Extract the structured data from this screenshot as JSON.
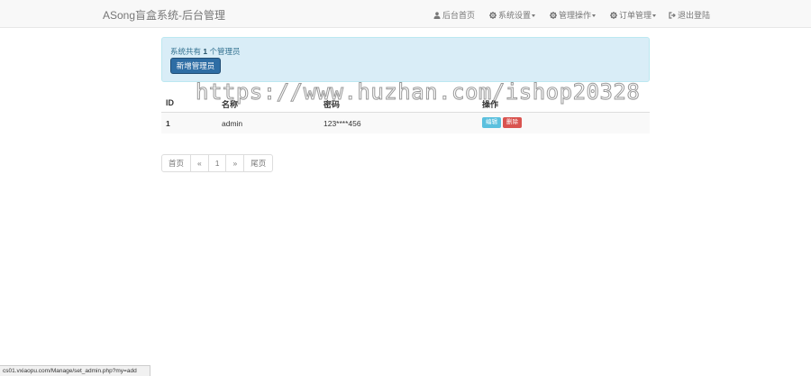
{
  "brand": "ASong盲盒系统-后台管理",
  "nav": {
    "home": "后台首页",
    "system": "系统设置",
    "manage": "管理操作",
    "orders": "订单管理",
    "logout": "退出登陆"
  },
  "icons": {
    "home": "user-icon",
    "system": "gear-icon",
    "manage": "gear-icon",
    "orders": "gear-icon",
    "logout": "logout-icon"
  },
  "alert": {
    "prefix": "系统共有",
    "count": "1",
    "suffix": "个管理员",
    "add_button": "新增管理员"
  },
  "table": {
    "headers": [
      "ID",
      "名称",
      "密码",
      "操作"
    ],
    "rows": [
      {
        "id": "1",
        "name": "admin",
        "password": "123****456",
        "edit": "编辑",
        "delete": "删除"
      }
    ]
  },
  "pagination": {
    "first": "首页",
    "prev": "«",
    "current": "1",
    "next": "»",
    "last": "尾页"
  },
  "watermark": "https://www.huzhan.com/ishop20328",
  "status_url": "cs01.vxiaopu.com/Manage/set_admin.php?my=add",
  "colors": {
    "primary": "#2e6da4",
    "alert_bg": "#d9edf7",
    "alert_text": "#31708f",
    "info": "#5bc0de",
    "danger": "#d9534f",
    "link": "#337ab7"
  }
}
